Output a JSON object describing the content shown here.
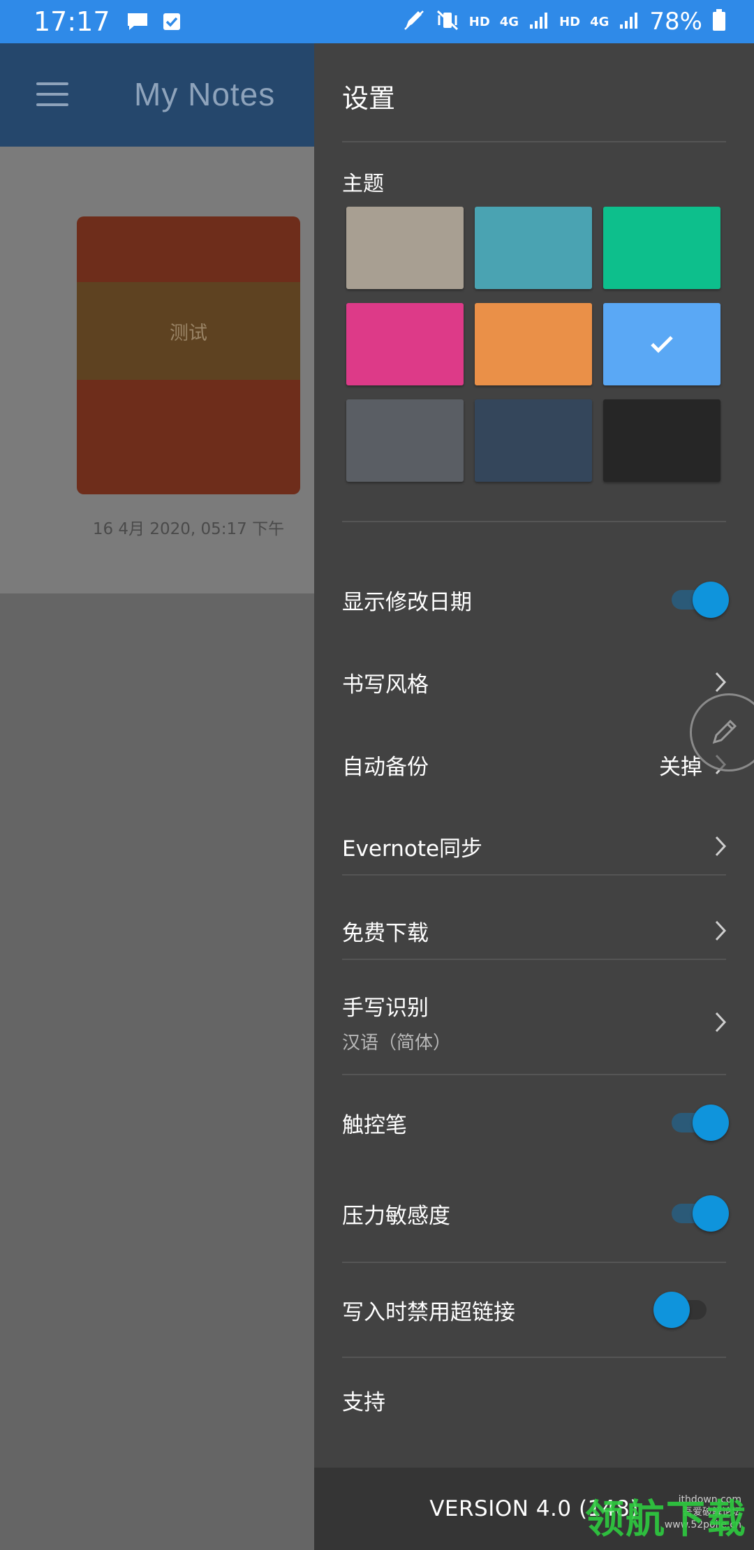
{
  "status_bar": {
    "time": "17:17",
    "network_1": "4G",
    "hd_1": "HD",
    "hd_2": "HD",
    "network_2": "4G",
    "battery": "78%"
  },
  "app": {
    "title": "My Notes",
    "note": {
      "title": "测试",
      "date": "16 4月 2020, 05:17 下午",
      "colors": {
        "card": "#6e2d1b",
        "band": "#5e4221"
      }
    }
  },
  "settings": {
    "title": "设置",
    "theme_label": "主题",
    "themes": [
      {
        "name": "beige",
        "color": "#a89f92",
        "selected": false
      },
      {
        "name": "teal",
        "color": "#4aa3b2",
        "selected": false
      },
      {
        "name": "green",
        "color": "#0dbf8c",
        "selected": false
      },
      {
        "name": "pink",
        "color": "#dd3a88",
        "selected": false
      },
      {
        "name": "orange",
        "color": "#ea9048",
        "selected": false
      },
      {
        "name": "blue",
        "color": "#5aa8f5",
        "selected": true
      },
      {
        "name": "grey",
        "color": "#5a5e64",
        "selected": false
      },
      {
        "name": "navy",
        "color": "#34465b",
        "selected": false
      },
      {
        "name": "black",
        "color": "#262626",
        "selected": false
      }
    ],
    "items": {
      "show_modified_date": {
        "label": "显示修改日期",
        "enabled": true
      },
      "writing_style": {
        "label": "书写风格"
      },
      "auto_backup": {
        "label": "自动备份",
        "value": "关掉"
      },
      "evernote_sync": {
        "label": "Evernote同步"
      },
      "free_download": {
        "label": "免费下载"
      },
      "handwriting_recognition": {
        "label": "手写识别",
        "value": "汉语（简体）"
      },
      "stylus": {
        "label": "触控笔",
        "enabled": true
      },
      "pressure_sensitivity": {
        "label": "压力敏感度",
        "enabled": true
      },
      "disable_hyperlinks": {
        "label": "写入时禁用超链接",
        "enabled": false
      },
      "support": {
        "label": "支持"
      }
    },
    "version": "VERSION 4.0 (148)",
    "accent_color": "#0f94dc"
  },
  "watermark": {
    "line1": "吾爱破解论坛",
    "line2": "www.52pojie.cn",
    "line3": "ithdown.com",
    "big": "领航下载"
  }
}
